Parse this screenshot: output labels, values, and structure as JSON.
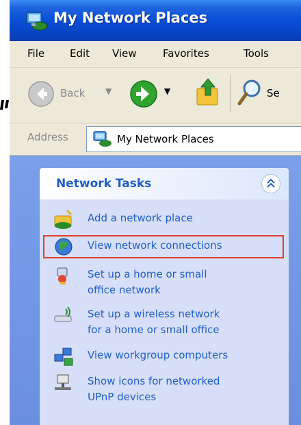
{
  "window": {
    "title": "My Network Places"
  },
  "menu": {
    "items": [
      "File",
      "Edit",
      "View",
      "Favorites",
      "Tools"
    ]
  },
  "toolbar": {
    "back_label": "Back",
    "search_label": "Se"
  },
  "address": {
    "label": "Address",
    "value": "My Network Places"
  },
  "tasks_panel": {
    "title": "Network Tasks",
    "items": [
      {
        "label": [
          "Add a network place"
        ],
        "icon": "add-network-place-icon"
      },
      {
        "label": [
          "View network connections"
        ],
        "icon": "network-connections-icon"
      },
      {
        "label": [
          "Set up a home or small",
          "office network"
        ],
        "icon": "home-network-wizard-icon"
      },
      {
        "label": [
          "Set up a wireless network",
          "for a home or small office"
        ],
        "icon": "wireless-network-icon"
      },
      {
        "label": [
          "View workgroup computers"
        ],
        "icon": "workgroup-computers-icon"
      },
      {
        "label": [
          "Show icons for networked",
          "UPnP devices"
        ],
        "icon": "upnp-devices-icon"
      }
    ]
  },
  "highlighted_item": "View network connections"
}
